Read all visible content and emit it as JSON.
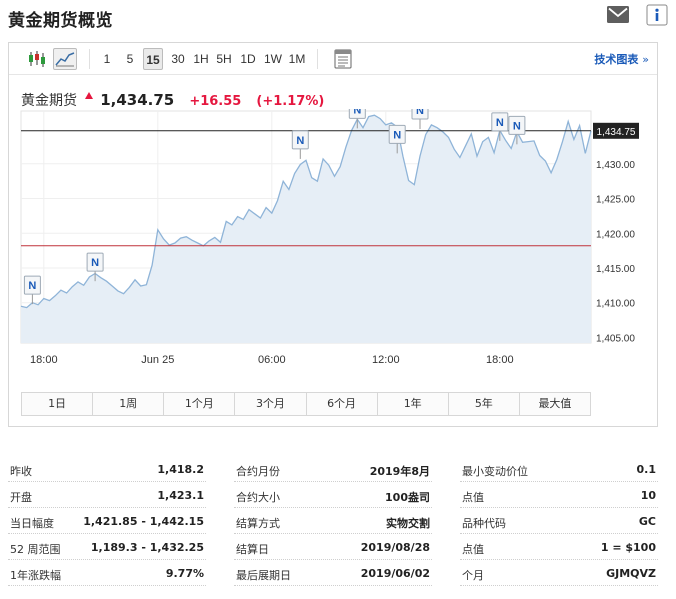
{
  "header": {
    "title": "黄金期货概览"
  },
  "toolbar": {
    "periods": [
      "1",
      "5",
      "15",
      "30",
      "1H",
      "5H",
      "1D",
      "1W",
      "1M"
    ],
    "active_period": "15",
    "tech_link": "技术图表",
    "tech_arrow": "»"
  },
  "quote": {
    "name": "黄金期货",
    "price": "1,434.75",
    "change": "+16.55",
    "change_pct": "(+1.17%)",
    "up_color": "#e5173f"
  },
  "chart_data": {
    "type": "area",
    "y_axis_labels": [
      "1,430.00",
      "1,425.00",
      "1,420.00",
      "1,415.00",
      "1,410.00",
      "1,405.00"
    ],
    "y_ticks": [
      1430,
      1425,
      1420,
      1415,
      1410,
      1405
    ],
    "ylim": [
      1404.2,
      1437.6
    ],
    "x_axis_labels": [
      "18:00",
      "Jun 25",
      "06:00",
      "12:00",
      "18:00"
    ],
    "x_ticks": [
      4,
      24,
      44,
      64,
      84
    ],
    "xlim": [
      0,
      100
    ],
    "current_price_label": "1,434.75",
    "current_price": 1434.75,
    "prev_close": 1418.2,
    "series": [
      {
        "x": [
          0,
          1,
          2,
          3,
          4,
          5,
          6,
          7,
          8,
          9,
          10,
          11,
          12,
          13,
          14,
          15,
          16,
          17,
          18,
          19,
          20,
          21,
          22,
          23,
          24,
          25,
          26,
          27,
          28,
          29,
          30,
          31,
          32,
          33,
          34,
          35,
          36,
          37,
          38,
          39,
          40,
          41,
          42,
          43,
          44,
          45,
          46,
          47,
          48,
          49,
          50,
          51,
          52,
          53,
          54,
          55,
          56,
          57,
          58,
          59,
          60,
          61,
          62,
          63,
          64,
          65,
          66,
          67,
          68,
          69,
          70,
          71,
          72,
          73,
          74,
          75,
          76,
          77,
          78,
          79,
          80,
          81,
          82,
          83,
          84,
          85,
          86,
          87,
          88,
          89,
          90,
          91,
          92,
          93,
          94,
          95,
          96,
          97,
          98,
          99,
          100
        ],
        "y": [
          1409.5,
          1409.3,
          1410.0,
          1409.7,
          1410.6,
          1410.3,
          1411.0,
          1411.8,
          1411.4,
          1412.3,
          1413.0,
          1412.5,
          1413.7,
          1414.2,
          1413.6,
          1413.1,
          1412.4,
          1411.7,
          1411.3,
          1412.2,
          1413.3,
          1412.4,
          1412.6,
          1415.4,
          1420.5,
          1419.2,
          1418.3,
          1418.6,
          1419.3,
          1419.5,
          1419.0,
          1418.6,
          1418.2,
          1418.9,
          1419.4,
          1418.7,
          1421.7,
          1421.2,
          1422.4,
          1422.0,
          1423.4,
          1422.8,
          1422.2,
          1423.7,
          1422.9,
          1424.7,
          1427.5,
          1426.3,
          1428.6,
          1429.9,
          1430.5,
          1428.0,
          1427.5,
          1430.7,
          1429.8,
          1428.2,
          1429.6,
          1432.4,
          1434.8,
          1436.4,
          1435.2,
          1436.8,
          1437.0,
          1436.5,
          1435.6,
          1435.9,
          1435.3,
          1431.1,
          1427.6,
          1427.0,
          1431.1,
          1434.2,
          1435.6,
          1435.2,
          1434.6,
          1433.8,
          1432.1,
          1430.9,
          1432.6,
          1434.3,
          1431.1,
          1433.2,
          1433.8,
          1431.6,
          1434.8,
          1433.4,
          1432.2,
          1434.6,
          1433.1,
          1433.2,
          1433.3,
          1431.2,
          1430.4,
          1428.7,
          1430.6,
          1433.2,
          1436.1,
          1433.5,
          1435.5,
          1431.5,
          1434.75
        ]
      }
    ],
    "event_markers": [
      {
        "label": "N",
        "x": 2,
        "y": 1409.8
      },
      {
        "label": "N",
        "x": 13,
        "y": 1413.1
      },
      {
        "label": "N",
        "x": 49,
        "y": 1430.7
      },
      {
        "label": "N",
        "x": 59,
        "y": 1435.1
      },
      {
        "label": "N",
        "x": 66,
        "y": 1431.5
      },
      {
        "label": "N",
        "x": 70,
        "y": 1435.0
      },
      {
        "label": "N",
        "x": 84,
        "y": 1433.3
      },
      {
        "label": "N",
        "x": 87,
        "y": 1432.8
      }
    ],
    "price_line_color": "#222222",
    "prev_close_color": "#c0323a",
    "series_color": "#8fb4d8",
    "fill_color": "#e6eef6"
  },
  "range_buttons": [
    "1日",
    "1周",
    "1个月",
    "3个月",
    "6个月",
    "1年",
    "5年",
    "最大值"
  ],
  "stats": {
    "col1": [
      {
        "label": "昨收",
        "value": "1,418.2"
      },
      {
        "label": "开盘",
        "value": "1,423.1"
      },
      {
        "label": "当日幅度",
        "value": "1,421.85 - 1,442.15"
      },
      {
        "label": "52 周范围",
        "value": "1,189.3 - 1,432.25"
      },
      {
        "label": "1年涨跌幅",
        "value": "9.77%"
      }
    ],
    "col2": [
      {
        "label": "合约月份",
        "value": "2019年8月"
      },
      {
        "label": "合约大小",
        "value": "100盎司"
      },
      {
        "label": "结算方式",
        "value": "实物交割"
      },
      {
        "label": "结算日",
        "value": "2019/08/28"
      },
      {
        "label": "最后展期日",
        "value": "2019/06/02"
      }
    ],
    "col3": [
      {
        "label": "最小变动价位",
        "value": "0.1"
      },
      {
        "label": "点值",
        "value": "10"
      },
      {
        "label": "品种代码",
        "value": "GC"
      },
      {
        "label": "点值",
        "value": "1 = $100"
      },
      {
        "label": "个月",
        "value": "GJMQVZ"
      }
    ]
  }
}
